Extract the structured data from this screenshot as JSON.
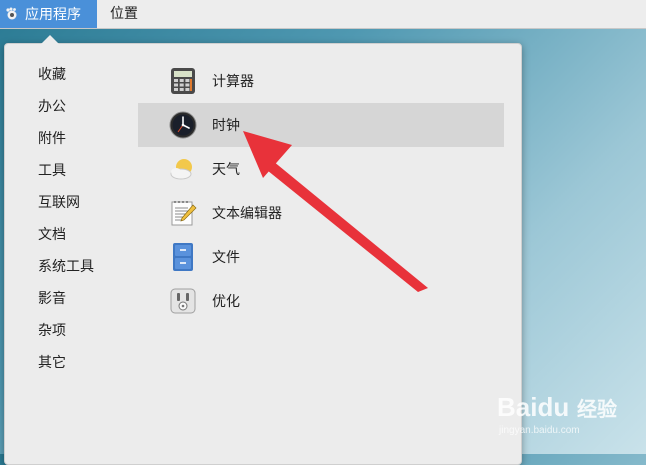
{
  "topbar": {
    "applications_label": "应用程序",
    "places_label": "位置"
  },
  "categories": [
    "收藏",
    "办公",
    "附件",
    "工具",
    "互联网",
    "文档",
    "系统工具",
    "影音",
    "杂项",
    "其它"
  ],
  "apps": [
    {
      "label": "计算器",
      "icon": "calculator-icon"
    },
    {
      "label": "时钟",
      "icon": "clock-icon",
      "selected": true
    },
    {
      "label": "天气",
      "icon": "weather-icon"
    },
    {
      "label": "文本编辑器",
      "icon": "text-editor-icon"
    },
    {
      "label": "文件",
      "icon": "file-cabinet-icon"
    },
    {
      "label": "优化",
      "icon": "tweak-icon"
    }
  ],
  "annotation": {
    "color": "#e8323a",
    "points_to": "时钟"
  },
  "watermark": {
    "brand": "Baidu",
    "cn": "经验",
    "url": "jingyan.baidu.com"
  },
  "colors": {
    "accent": "#4a90d9",
    "menu_bg": "#ececec",
    "selected_bg": "#d6d6d6"
  }
}
